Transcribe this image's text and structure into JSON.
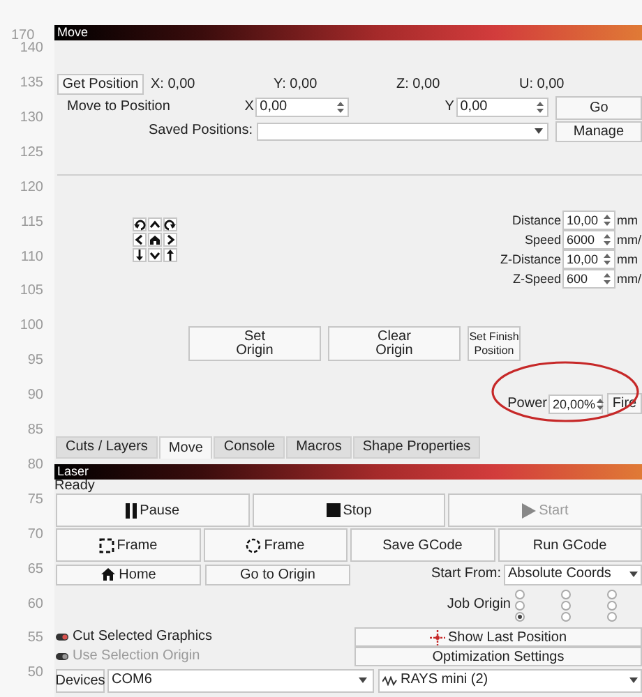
{
  "ruler_labels": [
    "170",
    "140",
    "135",
    "130",
    "125",
    "120",
    "115",
    "110",
    "105",
    "100",
    "95",
    "90",
    "85",
    "80",
    "75",
    "70",
    "65",
    "60",
    "55",
    "50"
  ],
  "move_panel": {
    "title": "Move",
    "get_position_button": "Get Position",
    "readouts": [
      "X: 0,00",
      "Y: 0,00",
      "Z: 0,00",
      "U: 0,00"
    ],
    "move_to_position": {
      "label": "Move to Position",
      "fields": [
        {
          "label": "X",
          "value": "0,00"
        },
        {
          "label": "Y",
          "value": "0,00"
        }
      ],
      "go_button": "Go"
    },
    "saved_positions": {
      "label": "Saved Positions:",
      "manage_button": "Manage"
    },
    "jog_settings": [
      {
        "label": "Distance",
        "value": "10,00",
        "unit": "mm"
      },
      {
        "label": "Speed",
        "value": "6000",
        "unit": "mm/"
      },
      {
        "label": "Z-Distance",
        "value": "10,00",
        "unit": "mm"
      },
      {
        "label": "Z-Speed",
        "value": "600",
        "unit": "mm/"
      }
    ],
    "origin_buttons": [
      {
        "lines": [
          "Set",
          "Origin"
        ]
      },
      {
        "lines": [
          "Clear",
          "Origin"
        ]
      },
      {
        "lines": [
          "Set Finish",
          "Position"
        ]
      }
    ],
    "power": {
      "label": "Power",
      "value": "20,00%",
      "fire_button": "Fire",
      "circled": true
    }
  },
  "tabs": [
    {
      "label": "Cuts / Layers",
      "selected": false
    },
    {
      "label": "Move",
      "selected": true
    },
    {
      "label": "Console",
      "selected": false
    },
    {
      "label": "Macros",
      "selected": false
    },
    {
      "label": "Shape Properties",
      "selected": false
    }
  ],
  "laser_panel": {
    "title": "Laser",
    "status": "Ready",
    "control_buttons": [
      {
        "kind": "pause",
        "label": "Pause",
        "disabled": false
      },
      {
        "kind": "stop",
        "label": "Stop",
        "disabled": false
      },
      {
        "kind": "start",
        "label": "Start",
        "disabled": true
      }
    ],
    "job_buttons": [
      {
        "kind": "frame-rect",
        "label": "Frame"
      },
      {
        "kind": "frame-circle",
        "label": "Frame"
      },
      {
        "kind": "plain",
        "label": "Save GCode"
      },
      {
        "kind": "plain",
        "label": "Run GCode"
      }
    ],
    "home_button": "Home",
    "go_to_origin_button": "Go to Origin",
    "start_from": {
      "label": "Start From:",
      "value": "Absolute Coords"
    },
    "job_origin": {
      "label": "Job Origin",
      "options": [
        {
          "selected": false
        },
        {
          "selected": false
        },
        {
          "selected": false
        },
        {
          "selected": false
        },
        {
          "selected": false
        },
        {
          "selected": false
        },
        {
          "selected": true
        },
        {
          "selected": false
        },
        {
          "selected": false
        }
      ]
    },
    "options": [
      {
        "label": "Cut Selected Graphics",
        "disabled": false
      },
      {
        "label": "Use Selection Origin",
        "disabled": true
      }
    ],
    "show_last_position_button": "Show Last Position",
    "optimization_settings_button": "Optimization Settings",
    "devices_button": "Devices",
    "port": "COM6",
    "device": "RAYS mini (2)"
  }
}
